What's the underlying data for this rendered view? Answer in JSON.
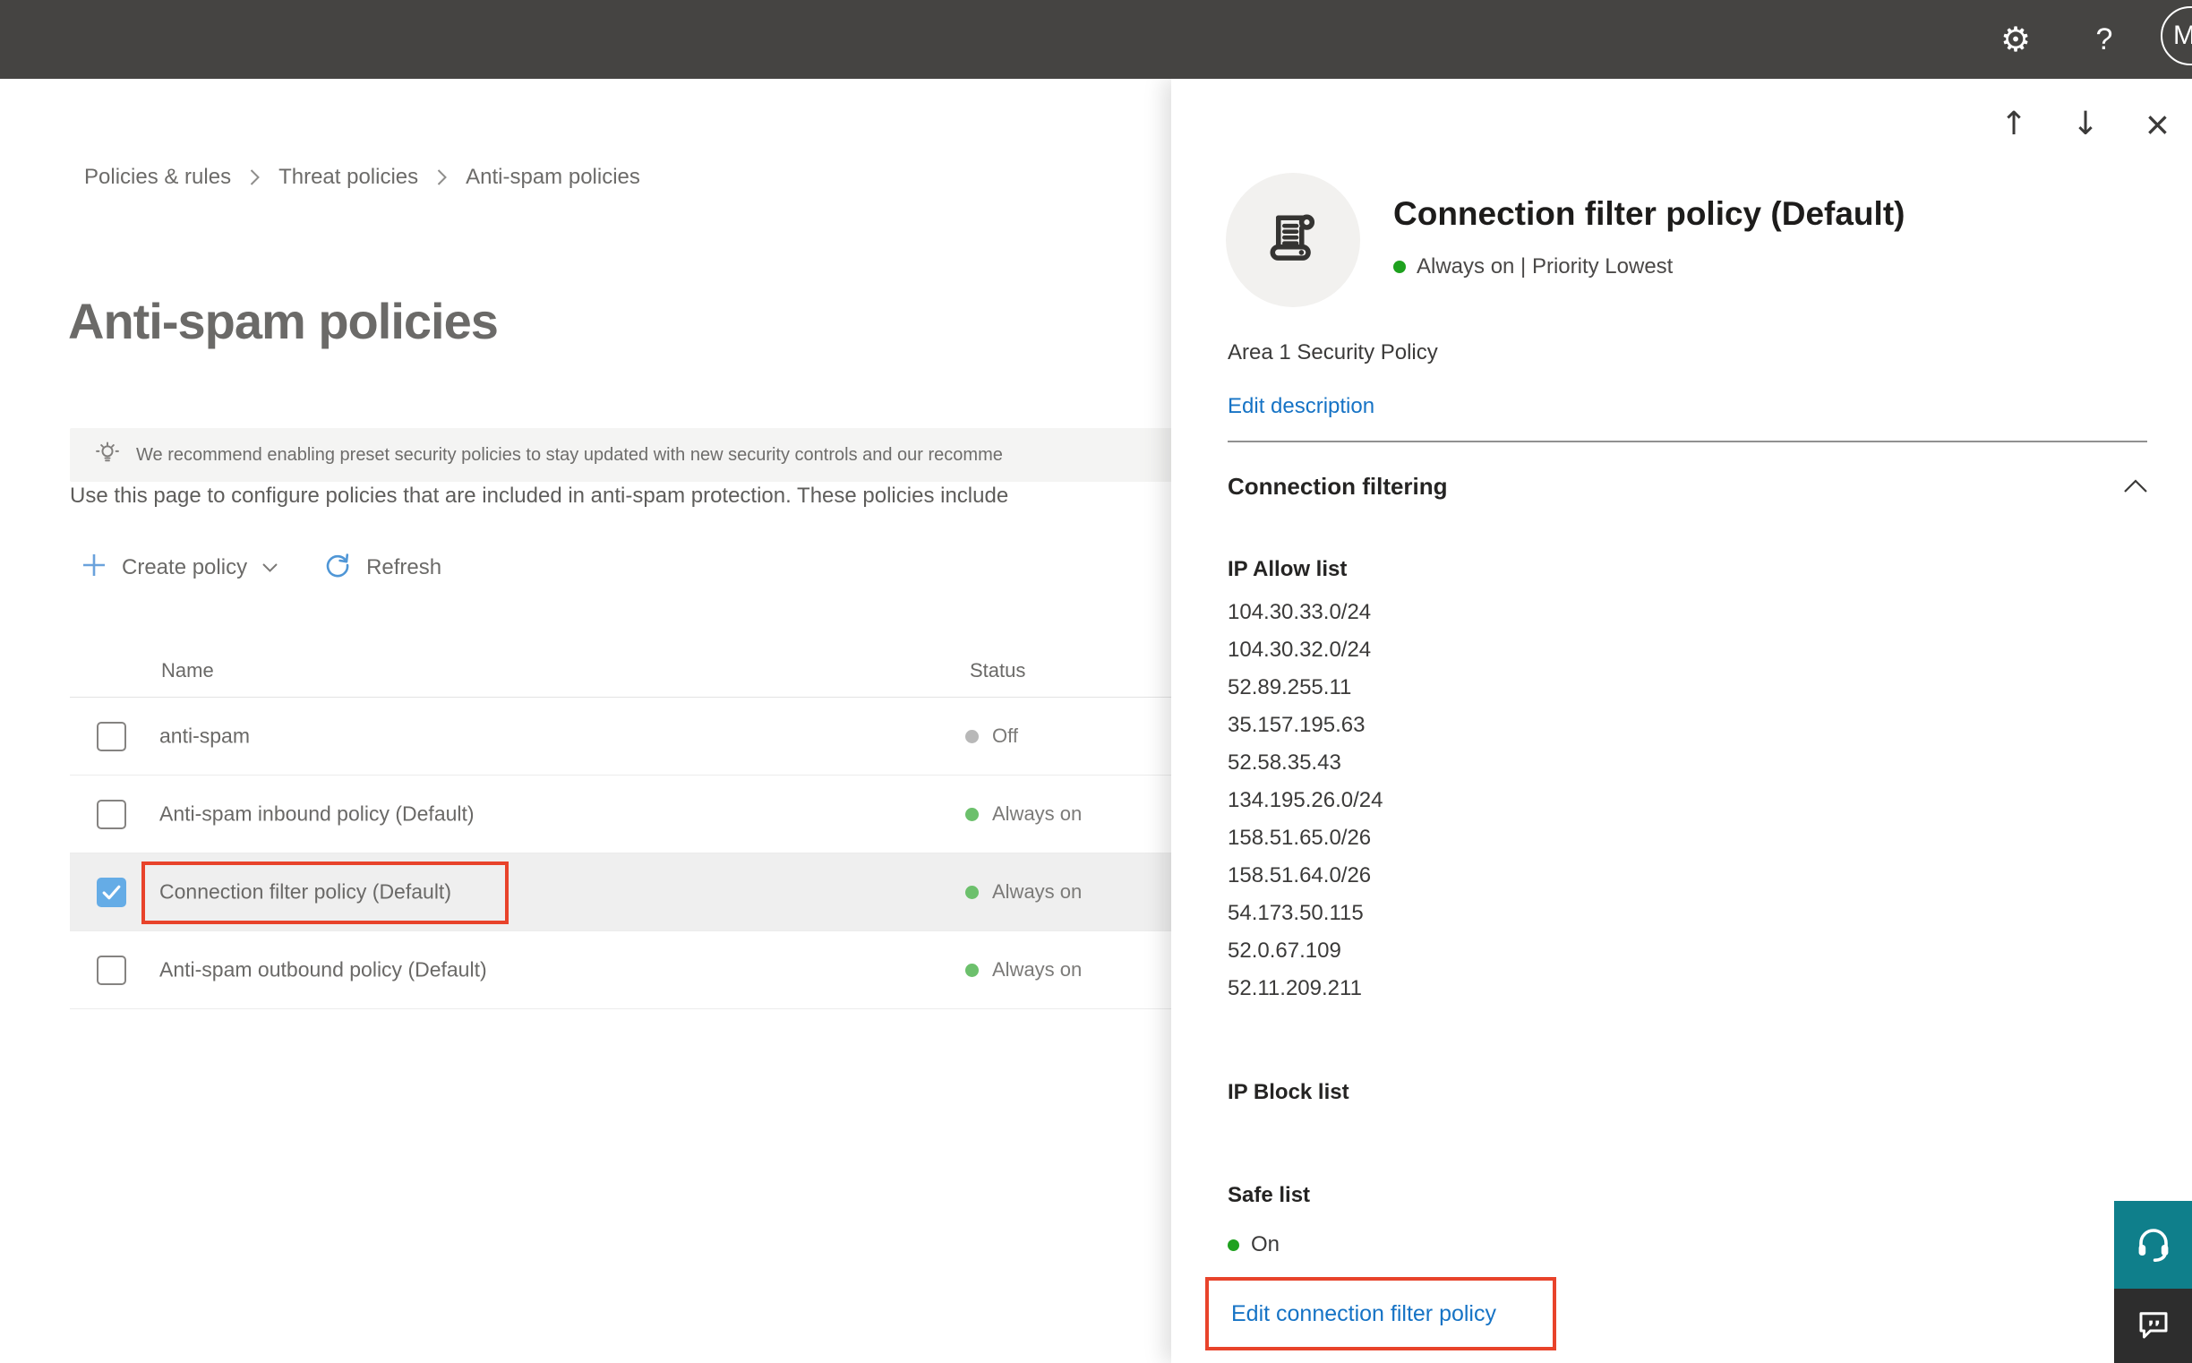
{
  "topbar": {
    "help_label": "?",
    "avatar_initial": "M"
  },
  "breadcrumb": {
    "items": [
      "Policies & rules",
      "Threat policies",
      "Anti-spam policies"
    ]
  },
  "page": {
    "title": "Anti-spam policies",
    "banner": {
      "text": "We recommend enabling preset security policies to stay updated with new security controls and our recomme"
    },
    "intro": "Use this page to configure policies that are included in anti-spam protection. These policies include",
    "toolbar": {
      "create_policy_label": "Create policy",
      "refresh_label": "Refresh"
    },
    "table": {
      "columns": {
        "name": "Name",
        "status": "Status"
      },
      "rows": [
        {
          "name": "anti-spam",
          "status": "Off"
        },
        {
          "name": "Anti-spam inbound policy (Default)",
          "status": "Always on"
        },
        {
          "name": "Connection filter policy (Default)",
          "status": "Always on"
        },
        {
          "name": "Anti-spam outbound policy (Default)",
          "status": "Always on"
        }
      ]
    }
  },
  "panel": {
    "title": "Connection filter policy (Default)",
    "status_line": "Always on | Priority Lowest",
    "description": "Area 1 Security Policy",
    "edit_description_label": "Edit description",
    "section": {
      "title": "Connection filtering",
      "ip_allow_label": "IP Allow list",
      "ip_allow_items": [
        "104.30.33.0/24",
        "104.30.32.0/24",
        "52.89.255.11",
        "35.157.195.63",
        "52.58.35.43",
        "134.195.26.0/24",
        "158.51.65.0/26",
        "158.51.64.0/26",
        "54.173.50.115",
        "52.0.67.109",
        "52.11.209.211"
      ],
      "ip_block_label": "IP Block list",
      "safe_list_label": "Safe list",
      "safe_list_value": "On",
      "edit_link_label": "Edit connection filter policy"
    }
  },
  "colors": {
    "topbar_bg": "#454442",
    "accent_blue": "#1673c5",
    "selection_red": "#e8432b",
    "status_on_green": "#6cc06c",
    "status_off_gray": "#b8b8b8",
    "panel_status_green": "#1ea11e",
    "checkbox_blue": "#65ace6",
    "selected_row_bg": "#efefef",
    "support_teal": "#0f7f8b",
    "feedback_dark": "#2d2d2d"
  }
}
